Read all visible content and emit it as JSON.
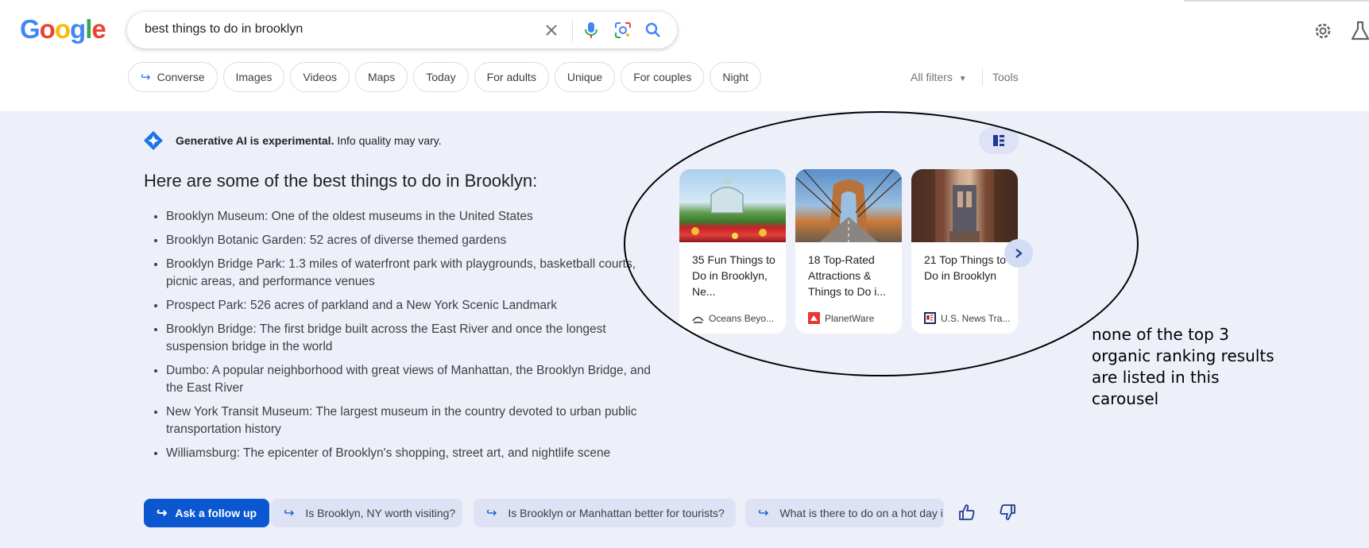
{
  "search": {
    "query": "best things to do in brooklyn"
  },
  "chips": [
    {
      "label": "Converse",
      "arrow": true
    },
    {
      "label": "Images"
    },
    {
      "label": "Videos"
    },
    {
      "label": "Maps"
    },
    {
      "label": "Today"
    },
    {
      "label": "For adults"
    },
    {
      "label": "Unique"
    },
    {
      "label": "For couples"
    },
    {
      "label": "Night"
    }
  ],
  "filters": {
    "all_filters": "All filters",
    "tools": "Tools"
  },
  "sge": {
    "disclaimer_bold": "Generative AI is experimental.",
    "disclaimer_rest": " Info quality may vary.",
    "heading": "Here are some of the best things to do in Brooklyn:",
    "bullets": [
      "Brooklyn Museum: One of the oldest museums in the United States",
      "Brooklyn Botanic Garden: 52 acres of diverse themed gardens",
      "Brooklyn Bridge Park: 1.3 miles of waterfront park with playgrounds, basketball courts, picnic areas, and performance venues",
      "Prospect Park: 526 acres of parkland and a New York Scenic Landmark",
      "Brooklyn Bridge: The first bridge built across the East River and once the longest suspension bridge in the world",
      "Dumbo: A popular neighborhood with great views of Manhattan, the Brooklyn Bridge, and the East River",
      "New York Transit Museum: The largest museum in the country devoted to urban public transportation history",
      "Williamsburg: The epicenter of Brooklyn's shopping, street art, and nightlife scene"
    ],
    "cards": [
      {
        "title": "35 Fun Things to Do in Brooklyn, Ne...",
        "source": "Oceans Beyo..."
      },
      {
        "title": "18 Top-Rated Attractions & Things to Do i...",
        "source": "PlanetWare"
      },
      {
        "title": "21 Top Things to Do in Brooklyn",
        "source": "U.S. News Tra..."
      }
    ],
    "ask_follow_up": "Ask a follow up",
    "follow_ups": [
      "Is Brooklyn, NY worth visiting?",
      "Is Brooklyn or Manhattan better for tourists?",
      "What is there to do on a hot day i"
    ]
  },
  "annotation": "none of the top 3 organic ranking results are listed in this carousel",
  "colors": {
    "accent": "#1a73e8",
    "ask_button": "#0b57d0",
    "panel_bg": "#eef0f9"
  }
}
